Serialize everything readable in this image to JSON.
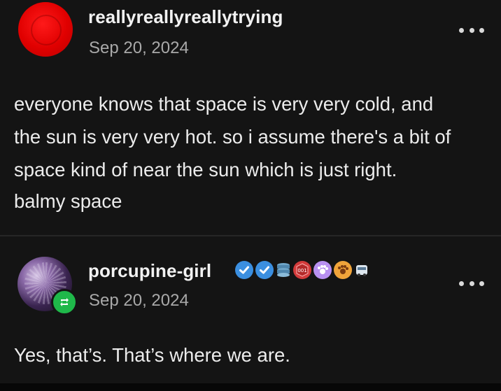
{
  "posts": [
    {
      "username": "reallyreallyreallytrying",
      "date": "Sep 20, 2024",
      "body_lines": [
        "everyone knows that space is very very cold, and",
        "the sun is very very hot. so i assume there's a bit of",
        "space kind of near the sun which is just right.",
        "balmy space"
      ],
      "more_icon": "more-horizontal-icon"
    },
    {
      "username": "porcupine-girl",
      "date": "Sep 20, 2024",
      "body_lines": [
        "Yes, that’s. That’s where we are."
      ],
      "more_icon": "more-horizontal-icon",
      "badge_text": "001",
      "reblog_icon": "reblog-icon"
    }
  ],
  "colors": {
    "background": "#141414",
    "text": "#e9e9e9",
    "date": "#a9a9a9",
    "verified": "#3b8fe0",
    "reblog": "#1fb84a",
    "avatar_red": "#e00000"
  }
}
